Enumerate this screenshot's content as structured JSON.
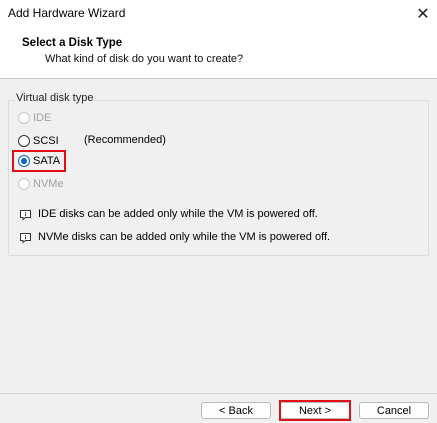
{
  "window": {
    "title": "Add Hardware Wizard",
    "close_glyph": "✕"
  },
  "header": {
    "title": "Select a Disk Type",
    "subtitle": "What kind of disk do you want to create?"
  },
  "disk_type_group": {
    "legend": "Virtual disk type",
    "options": [
      {
        "label": "IDE",
        "enabled": false,
        "checked": false
      },
      {
        "label": "SCSI",
        "enabled": true,
        "checked": false
      },
      {
        "label": "SATA",
        "enabled": true,
        "checked": true
      },
      {
        "label": "NVMe",
        "enabled": false,
        "checked": false
      }
    ],
    "scsi_note": "(Recommended)"
  },
  "notes": [
    {
      "icon": "info-bubble-icon",
      "text": "IDE disks can be added only while the VM is powered off."
    },
    {
      "icon": "info-bubble-icon",
      "text": "NVMe disks can be added only while the VM is powered off."
    }
  ],
  "footer": {
    "back_label": "< Back",
    "next_label": "Next >",
    "cancel_label": "Cancel"
  },
  "colors": {
    "highlight": "#e0101a",
    "accent": "#0a64c8"
  }
}
